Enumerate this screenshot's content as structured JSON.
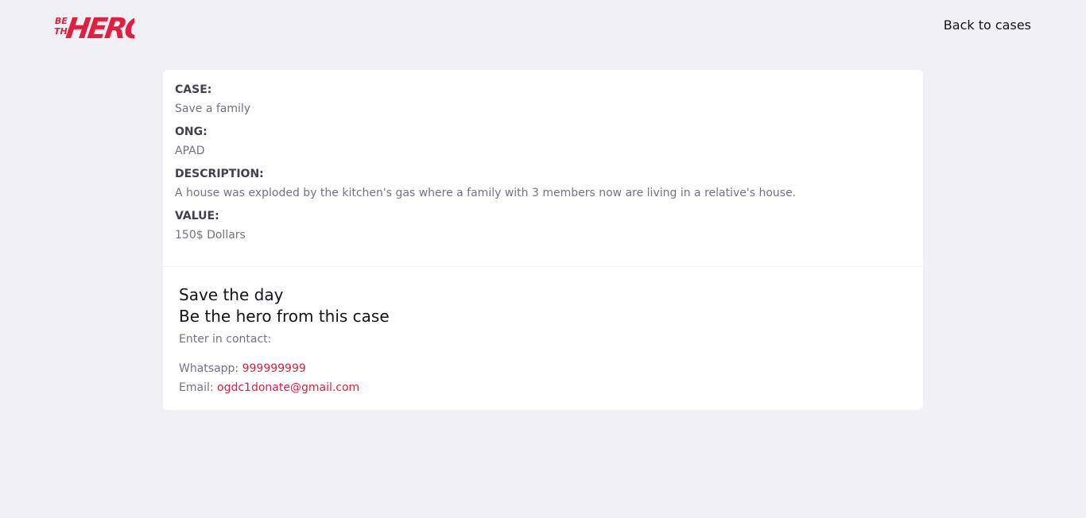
{
  "header": {
    "logo": {
      "small_words": [
        "BE",
        "THE"
      ],
      "big_word": "HERO",
      "color": "#e02041"
    },
    "back_link": "Back to cases"
  },
  "case_details": {
    "fields": [
      {
        "label": "CASE:",
        "value": "Save a family"
      },
      {
        "label": "ONG:",
        "value": "APAD"
      },
      {
        "label": "DESCRIPTION:",
        "value": "A house was exploded by the kitchen's gas where a family with 3 members now are living in a relative's house."
      },
      {
        "label": "VALUE:",
        "value": "150$ Dollars"
      }
    ]
  },
  "contact": {
    "title_line1": "Save the day",
    "title_line2": "Be the hero from this case",
    "subtitle": "Enter in contact:",
    "whatsapp_label": "Whatsapp:",
    "whatsapp_value": "999999999",
    "email_label": "Email:",
    "email_value": "ogdc1donate@gmail.com"
  },
  "colors": {
    "background": "#f0f0f5",
    "card": "#ffffff",
    "accent": "#e02041",
    "label": "#41414d",
    "muted": "#737380"
  }
}
